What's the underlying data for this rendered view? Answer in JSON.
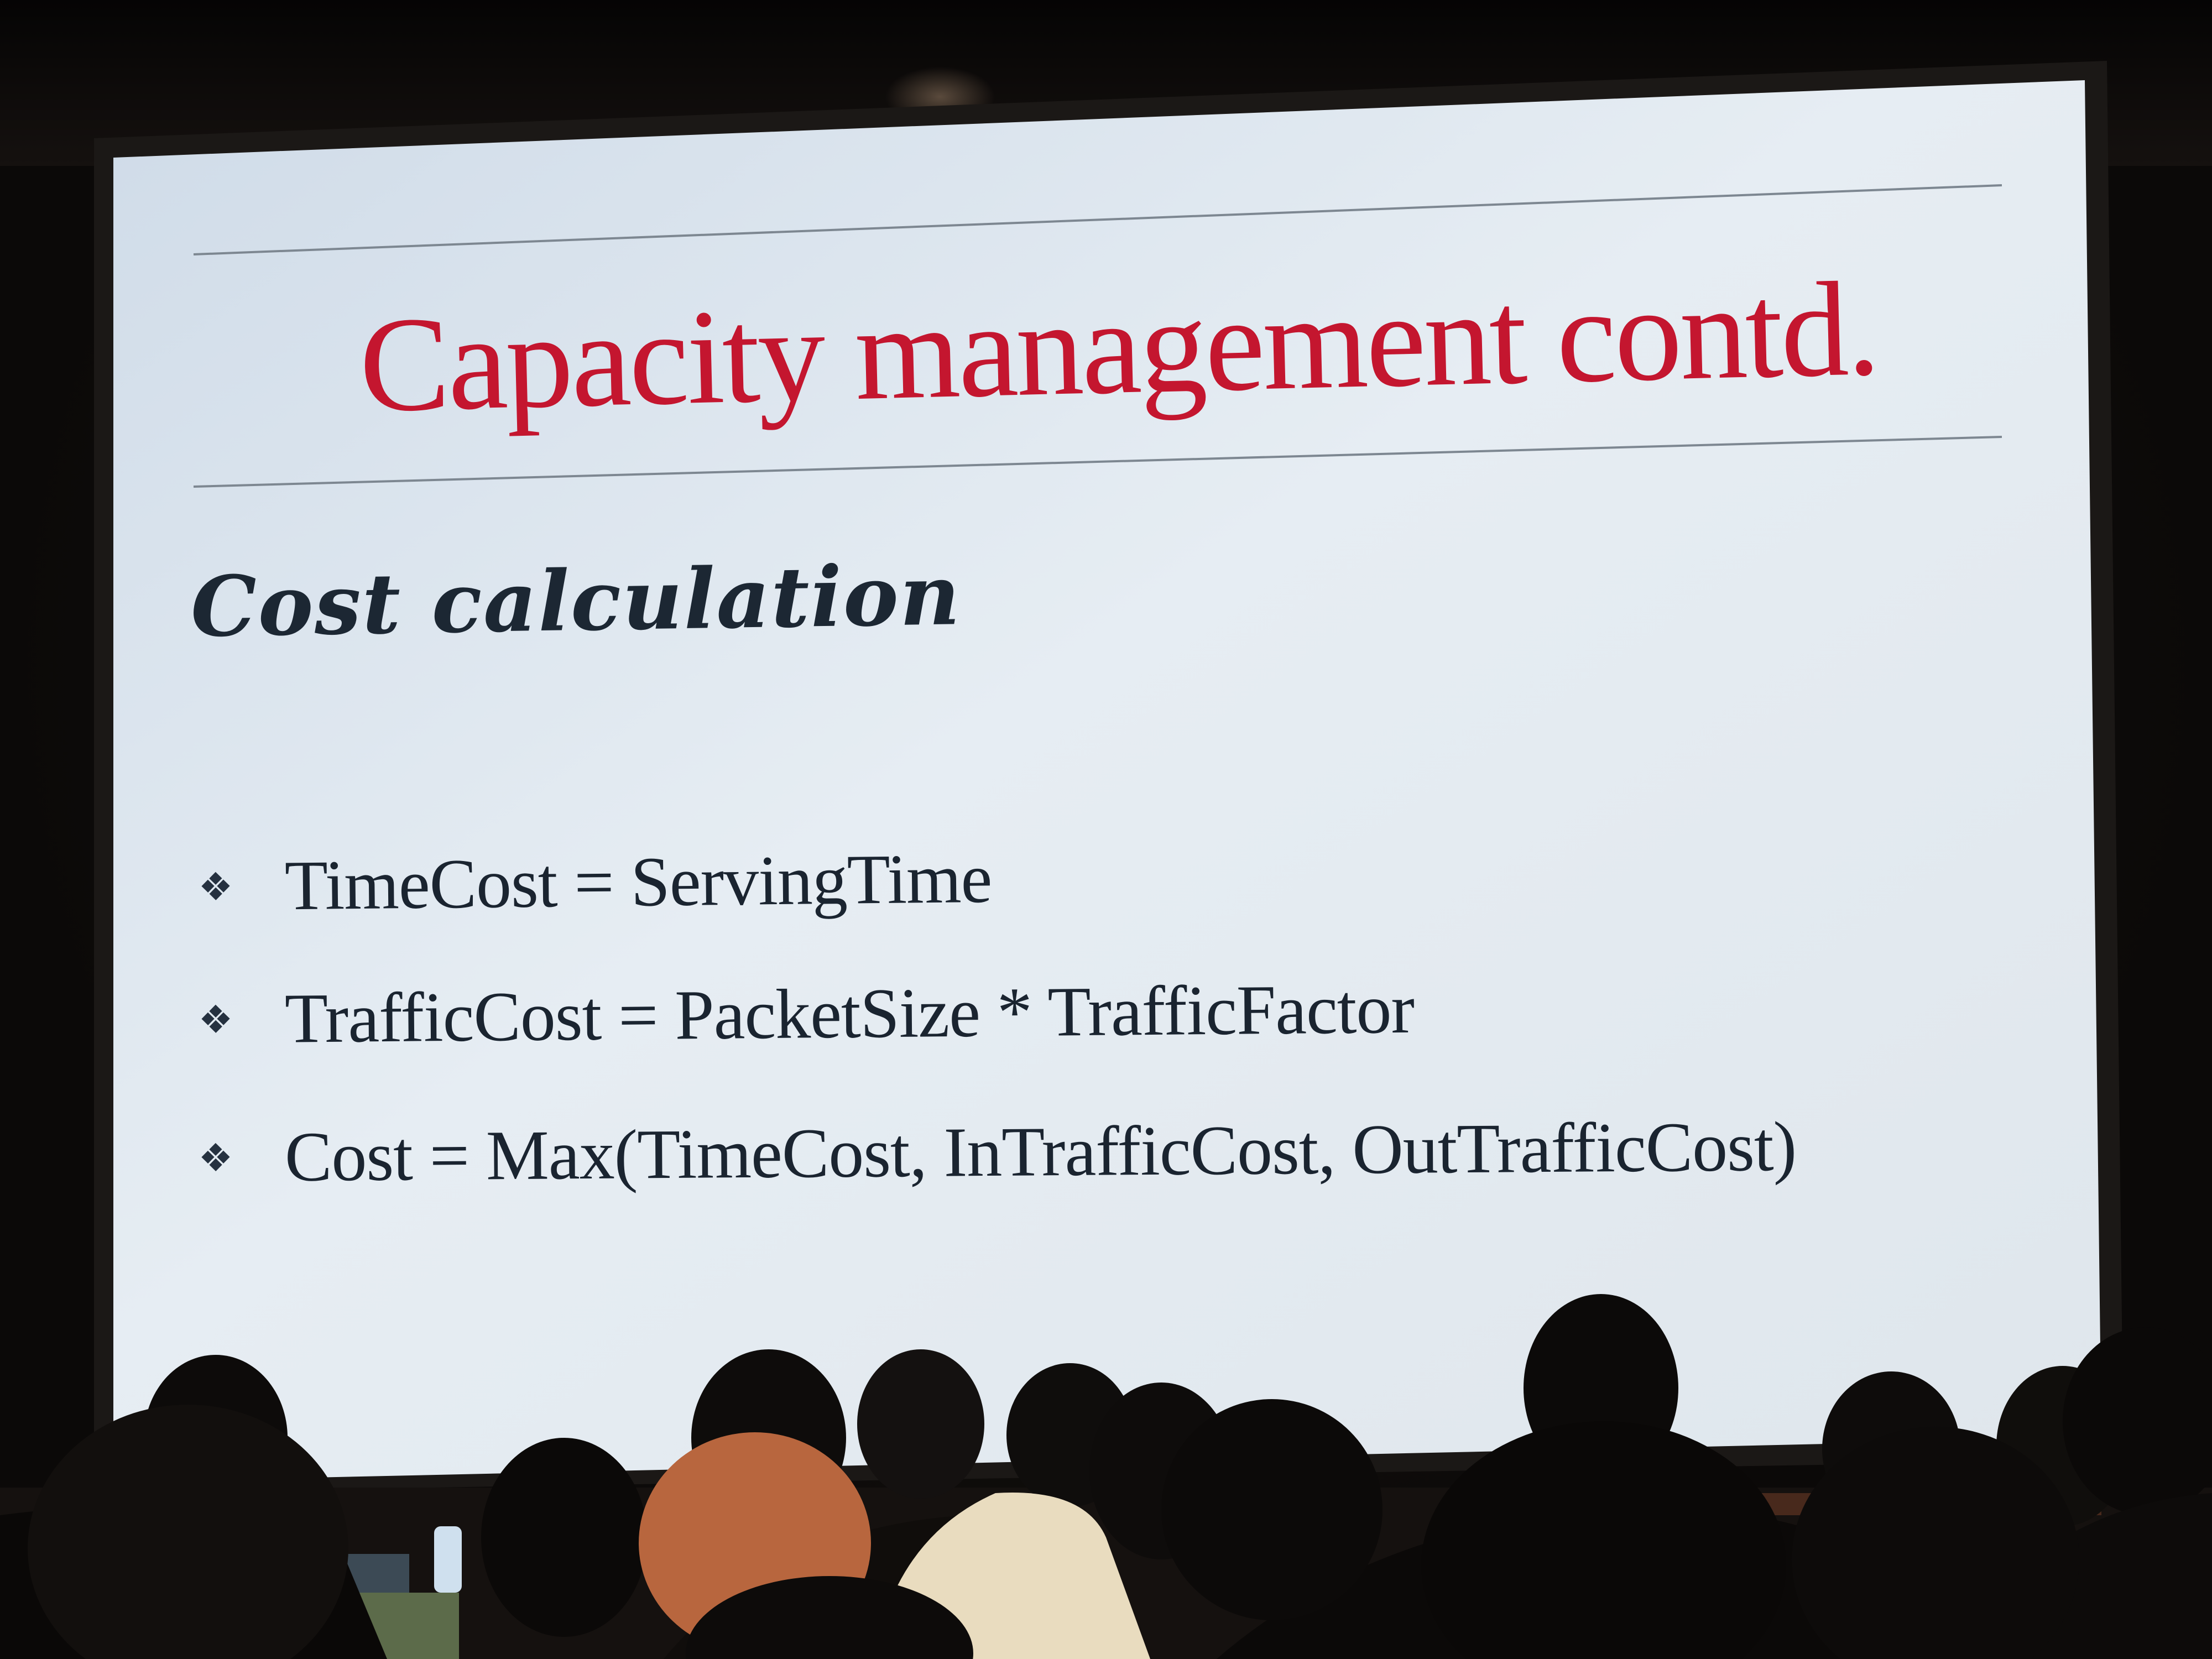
{
  "slide": {
    "title": "Capacity management contd.",
    "subtitle": "Cost calculation",
    "bullets": [
      {
        "icon": "diamond-bullet-icon",
        "text": "TimeCost = ServingTime"
      },
      {
        "icon": "diamond-bullet-icon",
        "text": "TrafficCost = PacketSize * TrafficFactor"
      },
      {
        "icon": "diamond-bullet-icon",
        "text": "Cost = Max(TimeCost, InTrafficCost, OutTrafficCost)"
      }
    ]
  },
  "colors": {
    "title": "#c4162f",
    "body_text": "#1a2430",
    "slide_background": "#dfe8f0",
    "room": "#0c0a09",
    "audience": "#0d0b0a"
  }
}
